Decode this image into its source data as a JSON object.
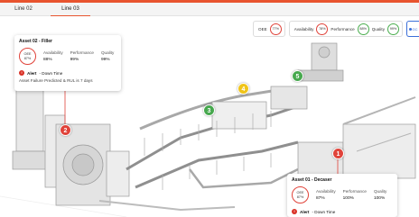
{
  "tabs": [
    {
      "label": "Line 02",
      "active": false
    },
    {
      "label": "Line 03",
      "active": true
    }
  ],
  "kpis": [
    {
      "label": "OEE",
      "value": "77%",
      "color": "#e0433a"
    },
    {
      "label": "Availability",
      "value": "78%",
      "color": "#e0433a"
    },
    {
      "label": "Performance",
      "value": "88%",
      "color": "#4bae4f"
    },
    {
      "label": "Quality",
      "value": "99%",
      "color": "#4bae4f"
    }
  ],
  "go_button": {
    "label": "GC"
  },
  "asset_02": {
    "title": "Asset 02 - Filler",
    "oee_label": "OEE",
    "oee_value": "87%",
    "availability_label": "Availability",
    "availability_value": "88%",
    "performance_label": "Performance",
    "performance_value": "99%",
    "quality_label": "Quality",
    "quality_value": "99%",
    "alert_label": "Alert",
    "alert_type": "- Down Time",
    "alert_desc": "Asset Failure Predicted & RUL is 7 days"
  },
  "asset_01": {
    "title": "Asset 01 - Decaser",
    "oee_label": "OEE",
    "oee_value": "87%",
    "availability_label": "Availability",
    "availability_value": "87%",
    "performance_label": "Performance",
    "performance_value": "100%",
    "quality_label": "Quality",
    "quality_value": "100%",
    "alert_label": "Alert",
    "alert_type": "- Down Time"
  },
  "pins": [
    {
      "label": "1",
      "status": "red"
    },
    {
      "label": "2",
      "status": "red"
    },
    {
      "label": "3",
      "status": "green"
    },
    {
      "label": "4",
      "status": "yellow"
    },
    {
      "label": "5",
      "status": "green"
    }
  ],
  "colors": {
    "accent": "#e8542f",
    "alert_red": "#e0433a",
    "ok_green": "#4bae4f",
    "warn_yellow": "#f0c419",
    "link_blue": "#3b6fd8"
  }
}
